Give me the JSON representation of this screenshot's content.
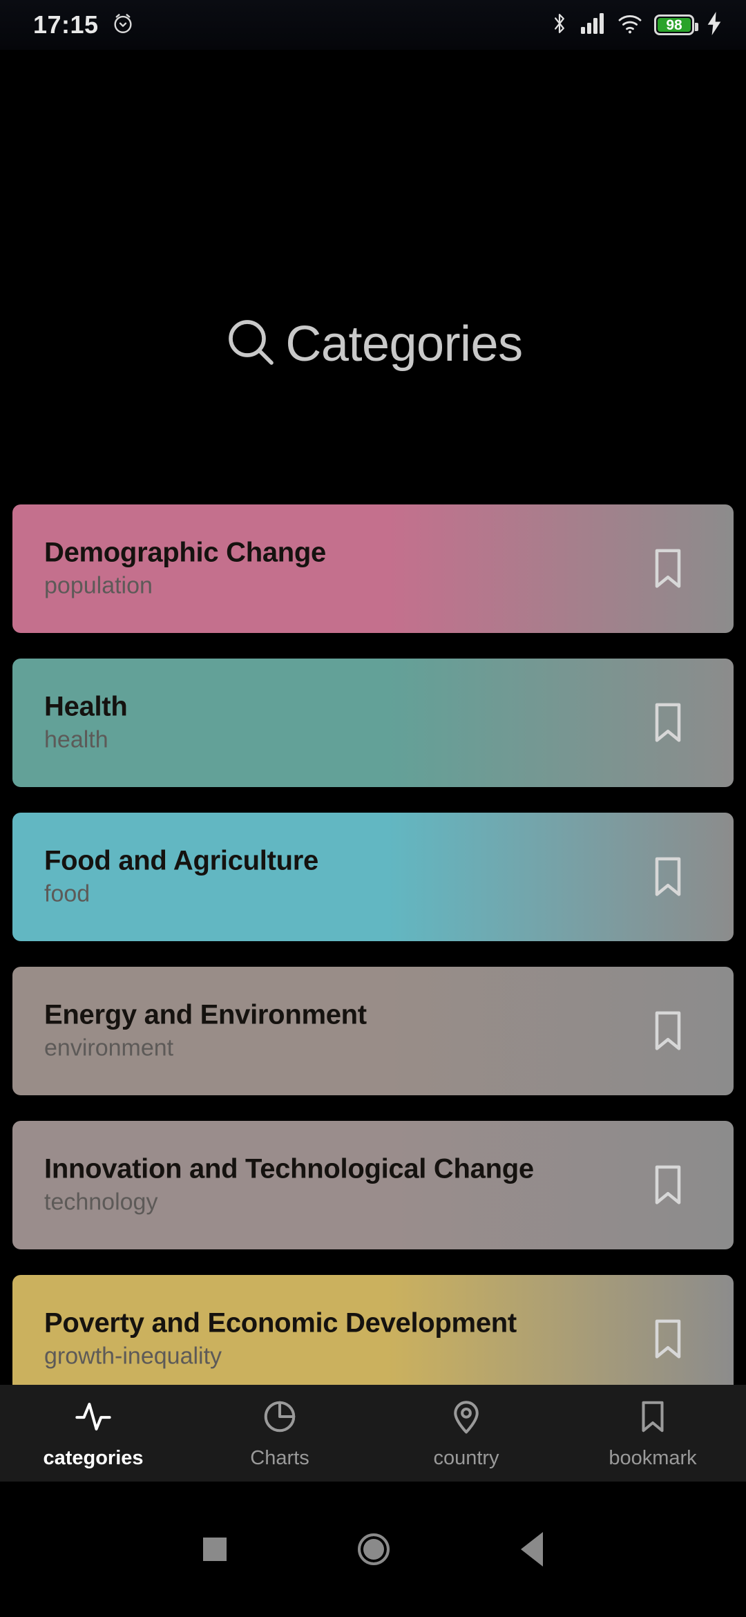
{
  "status_bar": {
    "time": "17:15",
    "alarm_icon": "alarm-clock-icon",
    "bluetooth_icon": "bluetooth-icon",
    "signal_icon": "cellular-signal-icon",
    "wifi_icon": "wifi-icon",
    "battery_level": "98",
    "battery_icon": "battery-icon",
    "charging_icon": "charging-bolt-icon",
    "battery_fill_color": "#2aa32a"
  },
  "header": {
    "title": "Categories",
    "search_icon": "search-icon",
    "title_color": "#c9c9c9"
  },
  "categories": [
    {
      "title": "Demographic Change",
      "slug": "population",
      "color": "#c4708d",
      "bookmark_icon": "bookmark-icon"
    },
    {
      "title": "Health",
      "slug": "health",
      "color": "#63a198",
      "bookmark_icon": "bookmark-icon"
    },
    {
      "title": "Food and Agriculture",
      "slug": "food",
      "color": "#62b7c2",
      "bookmark_icon": "bookmark-icon"
    },
    {
      "title": "Energy and Environment",
      "slug": "environment",
      "color": "#998d88",
      "bookmark_icon": "bookmark-icon"
    },
    {
      "title": "Innovation and Technological Change",
      "slug": "technology",
      "color": "#9a8d8c",
      "bookmark_icon": "bookmark-icon"
    },
    {
      "title": "Poverty and Economic Development",
      "slug": "growth-inequality",
      "color": "#cbb15e",
      "bookmark_icon": "bookmark-icon"
    }
  ],
  "partial_card": {
    "color": "#63a198"
  },
  "gradient_end_color": "#8c8c8c",
  "bottom_nav": {
    "items": [
      {
        "label": "categories",
        "icon": "activity-pulse-icon",
        "active": true
      },
      {
        "label": "Charts",
        "icon": "pie-chart-icon",
        "active": false
      },
      {
        "label": "country",
        "icon": "location-pin-icon",
        "active": false
      },
      {
        "label": "bookmark",
        "icon": "bookmark-icon",
        "active": false
      }
    ],
    "background_color": "#1b1b1b",
    "active_color": "#ffffff",
    "inactive_color": "#9a9a9a"
  },
  "system_nav": {
    "recents_icon": "square-recents-icon",
    "home_icon": "circle-home-icon",
    "back_icon": "triangle-back-icon",
    "color": "#8a8a8a"
  }
}
